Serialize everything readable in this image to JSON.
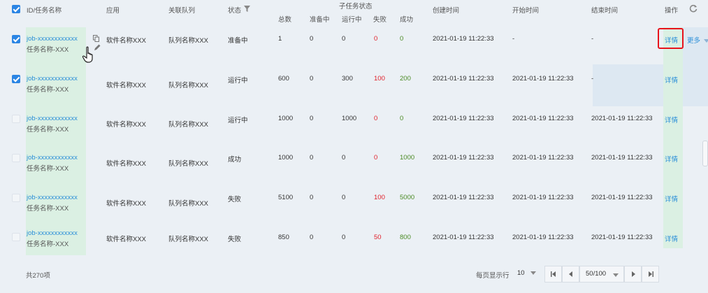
{
  "header": {
    "id_name": "ID/任务名称",
    "app": "应用",
    "queue": "关联队列",
    "status": "状态",
    "subtask_group": "子任务状态",
    "total": "总数",
    "preparing": "准备中",
    "running": "运行中",
    "failed": "失败",
    "success": "成功",
    "created": "创建时间",
    "started": "开始时间",
    "ended": "结束时间",
    "ops": "操作"
  },
  "rows": [
    {
      "job": "job-xxxxxxxxxxxx",
      "name": "任务名称-XXX",
      "app": "软件名称XXX",
      "queue": "队列名称XXX",
      "status": "准备中",
      "total": "1",
      "preparing": "0",
      "running": "0",
      "failed": "0",
      "success": "0",
      "created": "2021-01-19 11:22:33",
      "started": "-",
      "ended": "-",
      "detail": "详情",
      "more": "更多",
      "checked": true
    },
    {
      "job": "job-xxxxxxxxxxxx",
      "name": "任务名称-XXX",
      "app": "软件名称XXX",
      "queue": "队列名称XXX",
      "status": "运行中",
      "total": "600",
      "preparing": "0",
      "running": "300",
      "failed": "100",
      "success": "200",
      "created": "2021-01-19 11:22:33",
      "started": "2021-01-19 11:22:33",
      "ended": "-",
      "detail": "详情",
      "checked": true
    },
    {
      "job": "job-xxxxxxxxxxxx",
      "name": "任务名称-XXX",
      "app": "软件名称XXX",
      "queue": "队列名称XXX",
      "status": "运行中",
      "total": "1000",
      "preparing": "0",
      "running": "1000",
      "failed": "0",
      "success": "0",
      "created": "2021-01-19 11:22:33",
      "started": "2021-01-19 11:22:33",
      "ended": "2021-01-19 11:22:33",
      "detail": "详情",
      "checked": false
    },
    {
      "job": "job-xxxxxxxxxxxx",
      "name": "任务名称-XXX",
      "app": "软件名称XXX",
      "queue": "队列名称XXX",
      "status": "成功",
      "total": "1000",
      "preparing": "0",
      "running": "0",
      "failed": "0",
      "success": "1000",
      "created": "2021-01-19 11:22:33",
      "started": "2021-01-19 11:22:33",
      "ended": "2021-01-19 11:22:33",
      "detail": "详情",
      "checked": false
    },
    {
      "job": "job-xxxxxxxxxxxx",
      "name": "任务名称-XXX",
      "app": "软件名称XXX",
      "queue": "队列名称XXX",
      "status": "失败",
      "total": "5100",
      "preparing": "0",
      "running": "0",
      "failed": "100",
      "success": "5000",
      "created": "2021-01-19 11:22:33",
      "started": "2021-01-19 11:22:33",
      "ended": "2021-01-19 11:22:33",
      "detail": "详情",
      "checked": false
    },
    {
      "job": "job-xxxxxxxxxxxx",
      "name": "任务名称-XXX",
      "app": "软件名称XXX",
      "queue": "队列名称XXX",
      "status": "失败",
      "total": "850",
      "preparing": "0",
      "running": "0",
      "failed": "50",
      "success": "800",
      "created": "2021-01-19 11:22:33",
      "started": "2021-01-19 11:22:33",
      "ended": "2021-01-19 11:22:33",
      "detail": "详情",
      "checked": false
    }
  ],
  "footer": {
    "total_text": "共270项",
    "per_page_label": "每页显示行",
    "per_page_value": "10",
    "page_value": "50/100"
  },
  "colors": {
    "accent": "#2b8fd8",
    "highlight_box": "#e8141c",
    "failed": "#e0202a",
    "success": "#4a8a24"
  }
}
